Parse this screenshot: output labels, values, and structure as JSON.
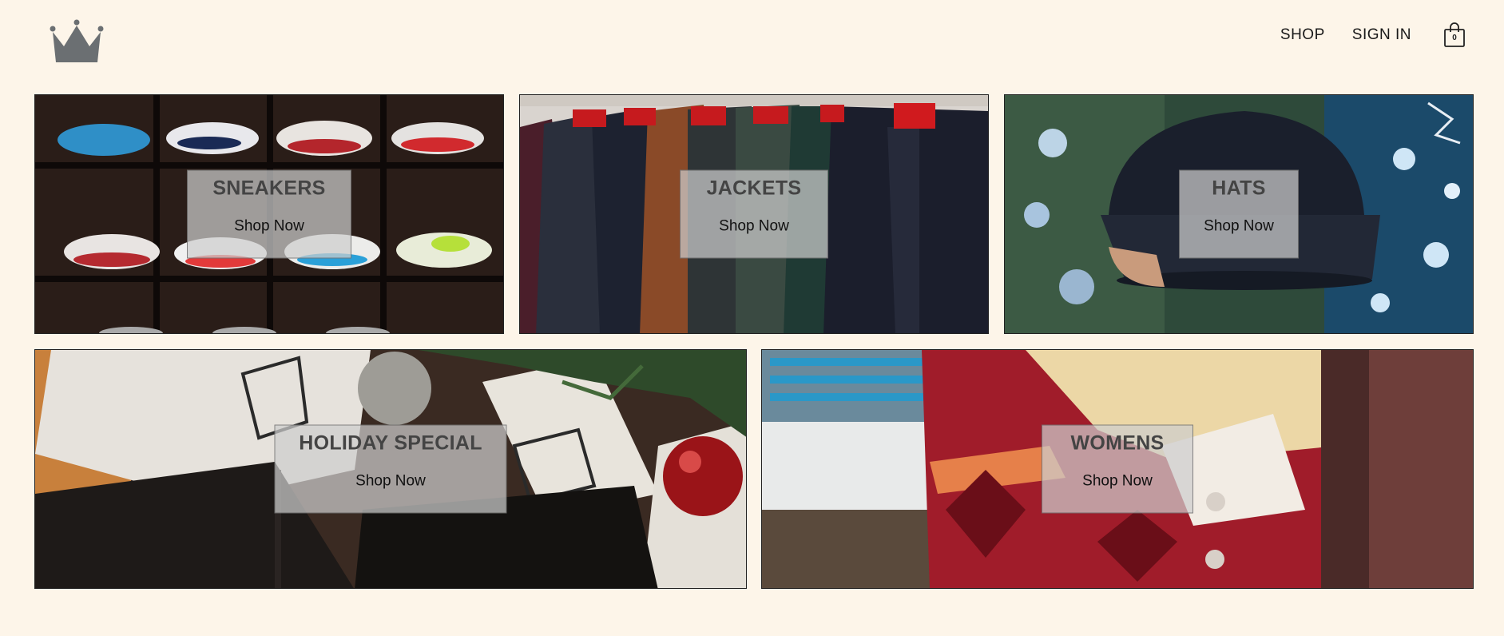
{
  "header": {
    "logo_icon": "crown-icon",
    "nav": {
      "shop_label": "SHOP",
      "signin_label": "SIGN IN"
    },
    "cart": {
      "icon": "shopping-bag-icon",
      "count": "0"
    }
  },
  "tiles": [
    {
      "title": "SNEAKERS",
      "cta": "Shop Now"
    },
    {
      "title": "JACKETS",
      "cta": "Shop Now"
    },
    {
      "title": "HATS",
      "cta": "Shop Now"
    },
    {
      "title": "HOLIDAY SPECIAL",
      "cta": "Shop Now"
    },
    {
      "title": "WOMENS",
      "cta": "Shop Now"
    }
  ],
  "colors": {
    "background": "#fdf5e9",
    "overlay": "#cdcdcd",
    "text_dark": "#444444"
  }
}
